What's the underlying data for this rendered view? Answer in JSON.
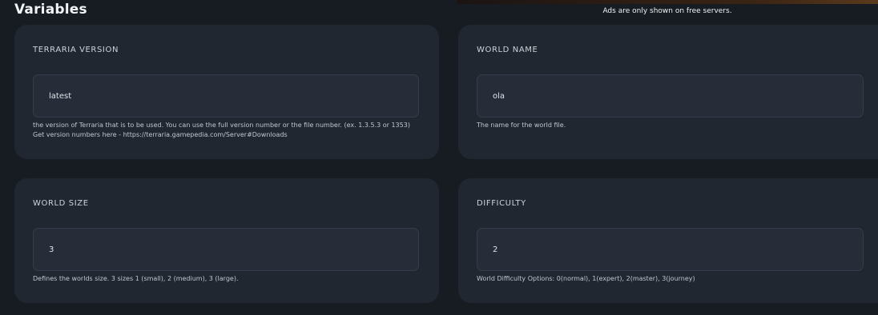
{
  "header": {
    "title": "Variables",
    "ad_note": "Ads are only shown on free servers."
  },
  "variables": [
    {
      "label": "TERRARIA VERSION",
      "value": "latest",
      "help_line1": "the version of Terraria that is to be used. You can use the full version number or the file number. (ex. 1.3.5.3 or 1353)",
      "help_line2": "Get version numbers here - https://terraria.gamepedia.com/Server#Downloads"
    },
    {
      "label": "WORLD NAME",
      "value": "ola",
      "help_line1": "The name for the world file."
    },
    {
      "label": "WORLD SIZE",
      "value": "3",
      "help_line1": "Defines the worlds size. 3 sizes 1 (small), 2 (medium), 3 (large)."
    },
    {
      "label": "DIFFICULTY",
      "value": "2",
      "help_line1": "World Difficulty Options: 0(normal), 1(expert), 2(master), 3(journey)"
    }
  ]
}
